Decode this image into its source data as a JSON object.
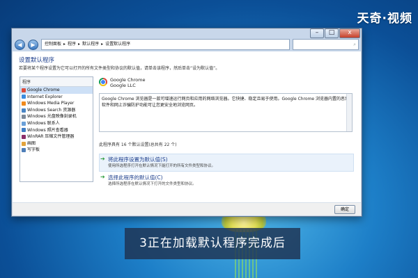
{
  "brand": "天奇·视频",
  "caption": "3正在加载默认程序完成后",
  "window": {
    "title_buttons": [
      "–",
      "□",
      "x"
    ],
    "nav_back_icon": "back-arrow-icon",
    "nav_forward_icon": "forward-arrow-icon",
    "breadcrumb": [
      "控制面板",
      "程序",
      "默认程序",
      "设置默认程序"
    ],
    "search_placeholder": "搜索控制面板"
  },
  "content": {
    "heading": "设置默认程序",
    "description": "若要将某个程序设置为它可以打开的所有文件类型和协议的默认值，请单击该程序，然后单击“设为默认值”。",
    "programs_header": "程序",
    "programs": [
      {
        "label": "Google Chrome",
        "color": "#dd4b39"
      },
      {
        "label": "Internet Explorer",
        "color": "#3a8de0"
      },
      {
        "label": "Windows Media Player",
        "color": "#f08a1c"
      },
      {
        "label": "Windows Search 资源器",
        "color": "#4a86c5"
      },
      {
        "label": "Windows 光盘映像刻录机",
        "color": "#7d8a99"
      },
      {
        "label": "Windows 联系人",
        "color": "#6aa0d8"
      },
      {
        "label": "Windows 照片查看器",
        "color": "#3f7ec5"
      },
      {
        "label": "WinRAR 压缩文件管理器",
        "color": "#8b2e6a"
      },
      {
        "label": "画图",
        "color": "#e2a33b"
      },
      {
        "label": "写字板",
        "color": "#4f7fb8"
      }
    ],
    "app_name": "Google Chrome",
    "vendor": "Google LLC",
    "app_description": "Google Chrome 浏览器是一款可增速运行网页和应用的网络浏览器。它快捷、稳定且易于使用。Google Chrome 浏览器内置的恶意软件和网上诈骗防护功能可让您更安全地浏览网页。",
    "defaults_count": "此程序具有 16 个默认设置(总共有 22 个)",
    "option1_title": "将此程序设置为默认值(S)",
    "option1_sub": "使用所选程序打开在默认情况下能打开的所有文件类型和协议。",
    "option2_title": "选择此程序的默认值(C)",
    "option2_sub": "选择所选程序在默认情况下打开的文件类型和协议。",
    "ok_label": "确定"
  }
}
